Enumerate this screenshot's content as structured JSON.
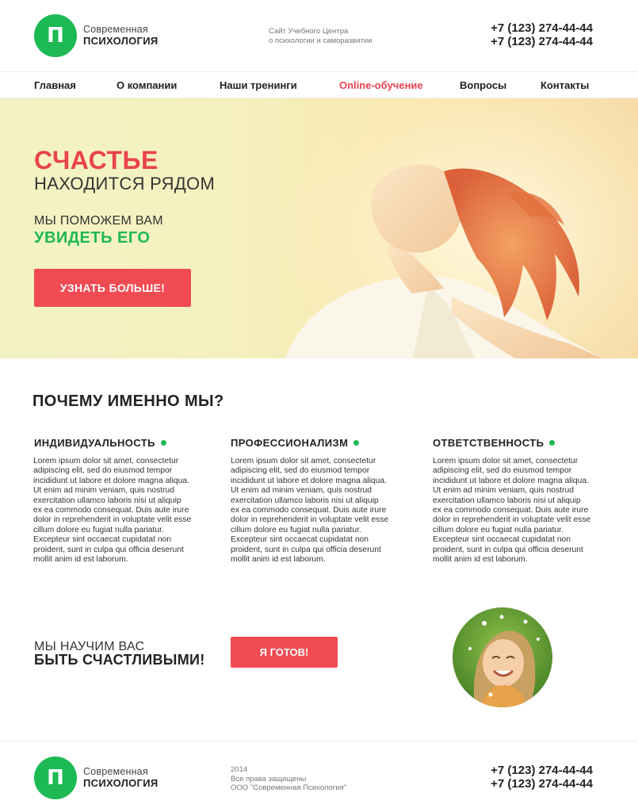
{
  "brand": {
    "logo_letter": "П",
    "name_line1": "Современная",
    "name_line2": "ПСИХОЛОГИЯ",
    "accent_green": "#1db954",
    "accent_red": "#f04b52"
  },
  "header": {
    "tagline_line1": "Сайт Учебного Центра",
    "tagline_line2": "о психологии и саморазвитии",
    "phone1": "+7 (123) 274-44-44",
    "phone2": "+7 (123) 274-44-44"
  },
  "nav": {
    "items": [
      {
        "label": "Главная"
      },
      {
        "label": "О компании"
      },
      {
        "label": "Наши тренинги"
      },
      {
        "label": "Online-обучение"
      },
      {
        "label": "Вопросы"
      },
      {
        "label": "Контакты"
      }
    ],
    "active_index": 3
  },
  "hero": {
    "title_line1": "СЧАСТЬЕ",
    "title_line2": "НАХОДИТСЯ РЯДОМ",
    "sub_line1": "МЫ ПОМОЖЕМ ВАМ",
    "sub_line2": "УВИДЕТЬ ЕГО",
    "button_label": "УЗНАТЬ БОЛЬШЕ!"
  },
  "why": {
    "title": "ПОЧЕМУ ИМЕННО МЫ?",
    "features": [
      {
        "title": "ИНДИВИДУАЛЬНОСТЬ",
        "text": "Lorem ipsum dolor sit amet, consectetur adipiscing elit, sed do eiusmod tempor incididunt ut labore et dolore magna aliqua. Ut enim ad minim veniam, quis nostrud exercitation ullamco laboris nisi ut aliquip ex ea commodo consequat. Duis aute irure dolor in reprehenderit in voluptate velit esse cillum dolore eu fugiat nulla pariatur. Excepteur sint occaecat cupidatat non proident, sunt in culpa qui officia deserunt mollit anim id est laborum."
      },
      {
        "title": "ПРОФЕССИОНАЛИЗМ",
        "text": "Lorem ipsum dolor sit amet, consectetur adipiscing elit, sed do eiusmod tempor incididunt ut labore et dolore magna aliqua. Ut enim ad minim veniam, quis nostrud exercitation ullamco laboris nisi ut aliquip ex ea commodo consequat. Duis aute irure dolor in reprehenderit in voluptate velit esse cillum dolore eu fugiat nulla pariatur. Excepteur sint occaecat cupidatat non proident, sunt in culpa qui officia deserunt mollit anim id est laborum."
      },
      {
        "title": "ОТВЕТСТВЕННОСТЬ",
        "text": "Lorem ipsum dolor sit amet, consectetur adipiscing elit, sed do eiusmod tempor incididunt ut labore et dolore magna aliqua. Ut enim ad minim veniam, quis nostrud exercitation ullamco laboris nisi ut aliquip ex ea commodo consequat. Duis aute irure dolor in reprehenderit in voluptate velit esse cillum dolore eu fugiat nulla pariatur. Excepteur sint occaecat cupidatat non proident, sunt in culpa qui officia deserunt mollit anim id est laborum."
      }
    ]
  },
  "cta": {
    "line1": "МЫ НАУЧИМ ВАС",
    "line2": "БЫТЬ СЧАСТЛИВЫМИ!",
    "button_label": "Я ГОТОВ!"
  },
  "footer": {
    "year": "2014",
    "rights": "Все права защищены",
    "company": "ООО \"Современная Психология\"",
    "phone1": "+7 (123) 274-44-44",
    "phone2": "+7 (123) 274-44-44"
  }
}
